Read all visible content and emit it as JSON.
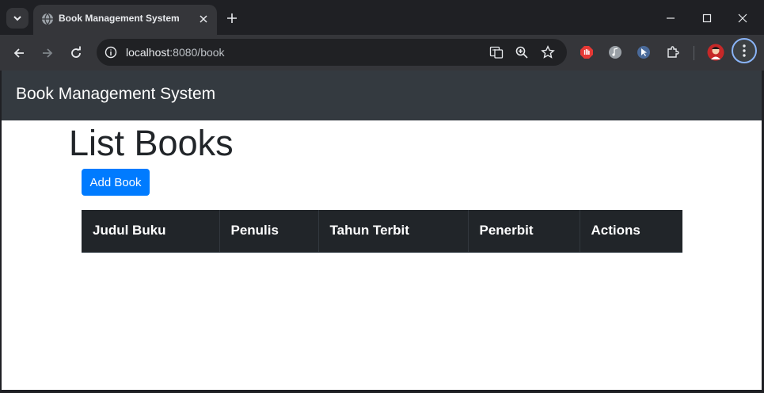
{
  "browser": {
    "tab_title": "Book Management System",
    "url_host": "localhost",
    "url_path": ":8080/book"
  },
  "page": {
    "brand": "Book Management System",
    "title": "List Books",
    "add_button_label": "Add Book",
    "table": {
      "columns": [
        "Judul Buku",
        "Penulis",
        "Tahun Terbit",
        "Penerbit",
        "Actions"
      ],
      "rows": []
    }
  },
  "colors": {
    "navbar_bg": "#343a40",
    "table_header_bg": "#212529",
    "primary_button": "#007bff"
  },
  "icons": {
    "tab_search": "chevron-down-icon",
    "favicon": "globe-icon",
    "close": "close-icon",
    "new_tab": "plus-icon",
    "back": "back-arrow-icon",
    "forward": "forward-arrow-icon",
    "reload": "reload-icon",
    "site_info": "info-icon",
    "translate": "translate-icon",
    "zoom": "zoom-icon",
    "bookmark": "star-icon",
    "extensions": "puzzle-icon",
    "menu": "kebab-menu-icon"
  }
}
